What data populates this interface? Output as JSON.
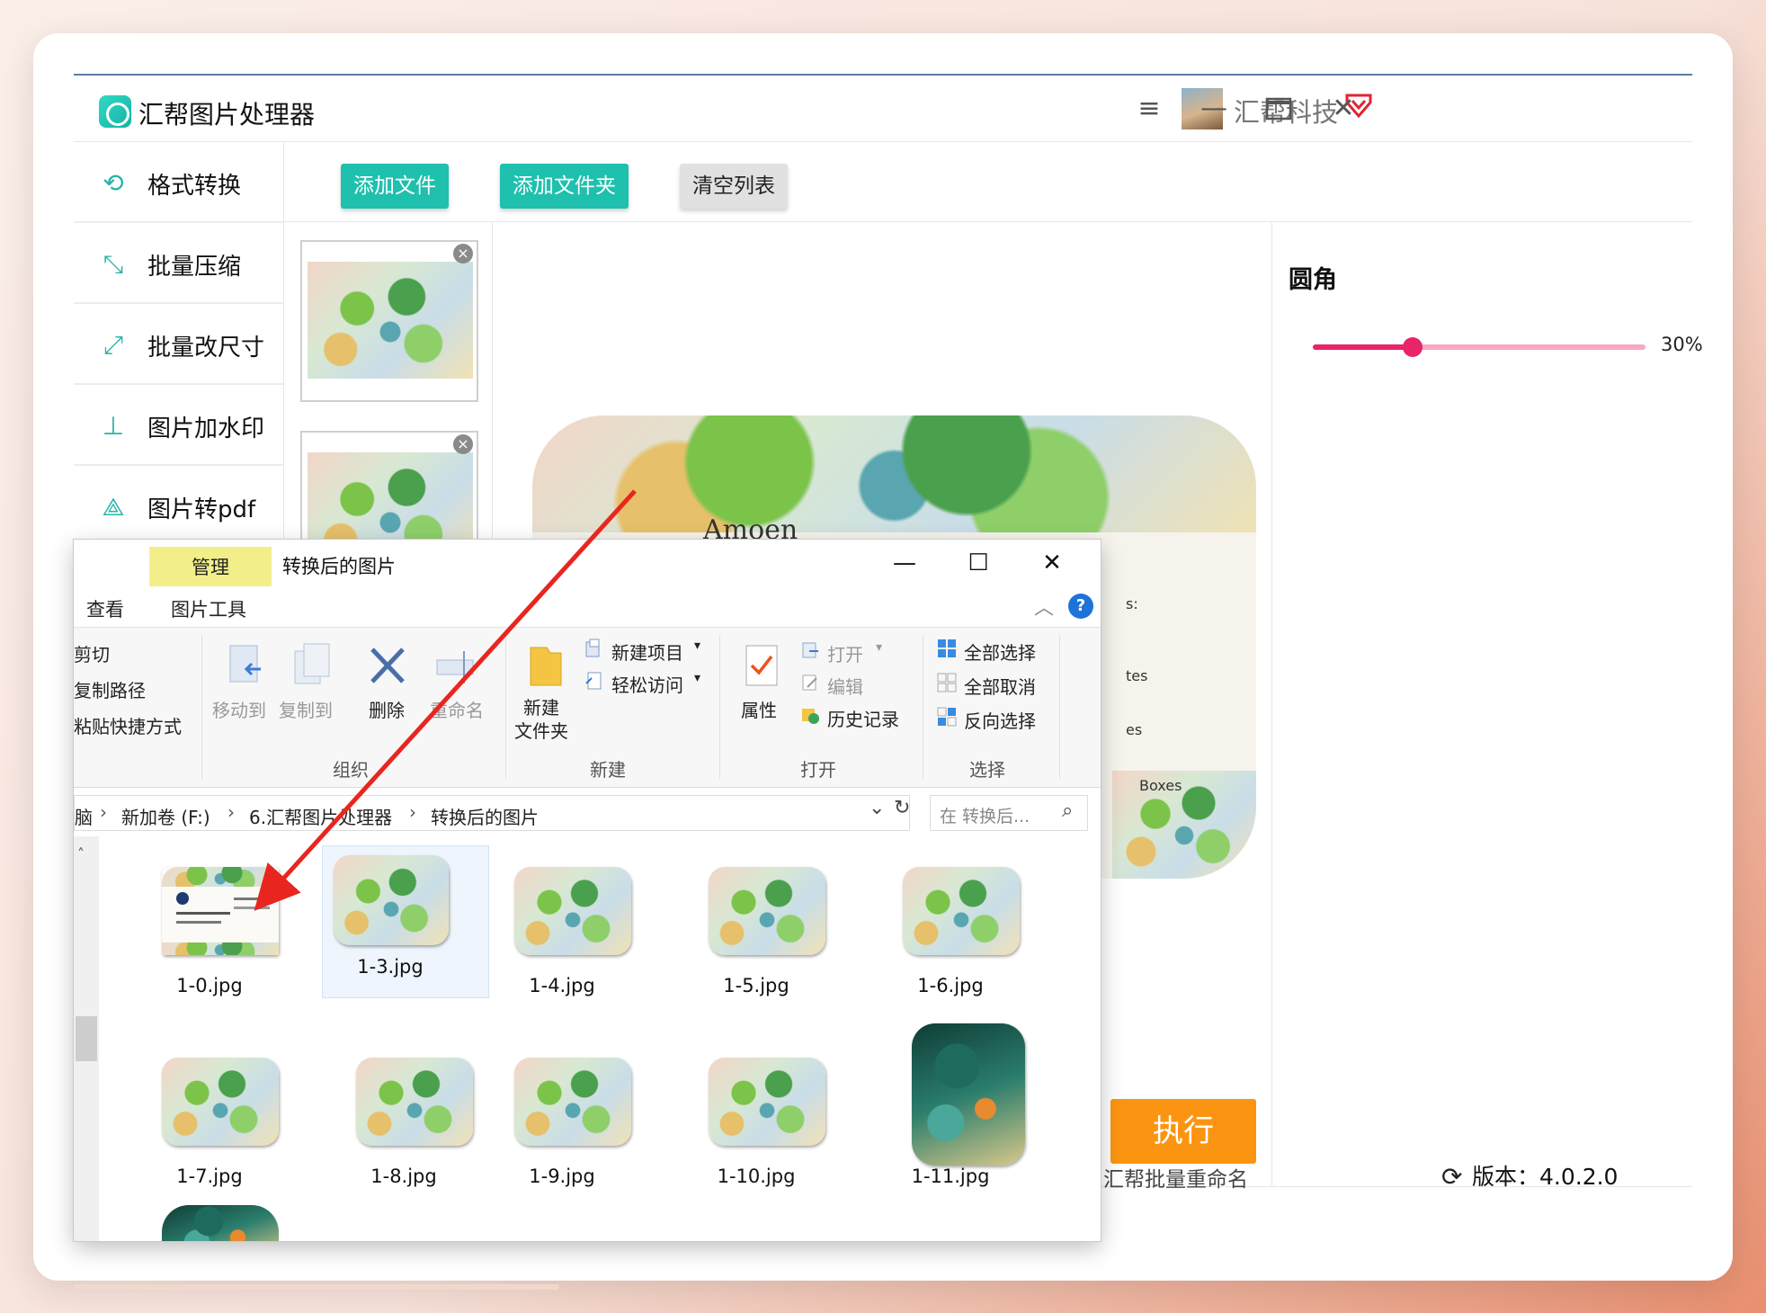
{
  "app": {
    "title": "汇帮图片处理器",
    "company": "汇帮科技",
    "window_controls": [
      "menu-icon",
      "minimize-icon",
      "maximize-icon",
      "close-icon"
    ]
  },
  "sidebar": {
    "items": [
      {
        "label": "格式转换",
        "icon": "format-convert-icon"
      },
      {
        "label": "批量压缩",
        "icon": "compress-icon"
      },
      {
        "label": "批量改尺寸",
        "icon": "resize-icon"
      },
      {
        "label": "图片加水印",
        "icon": "watermark-icon"
      },
      {
        "label": "图片转pdf",
        "icon": "pdf-icon"
      }
    ]
  },
  "toolbar": {
    "add_file": "添加文件",
    "add_folder": "添加文件夹",
    "clear_list": "清空列表"
  },
  "settings": {
    "title": "圆角",
    "slider_value_label": "30%",
    "slider_fraction": 0.3
  },
  "preview": {
    "texts": [
      "Amoen",
      "s:",
      "tes",
      "es",
      "Boxes"
    ]
  },
  "execute_label": "执行",
  "footer": {
    "link": "汇帮批量重命名",
    "version": "版本：4.0.2.0"
  },
  "explorer": {
    "manage_tab": "管理",
    "title": "转换后的图片",
    "tabs": [
      "查看",
      "图片工具"
    ],
    "ribbon": {
      "clipboard": [
        "剪切",
        "复制路径",
        "粘贴快捷方式"
      ],
      "move_to": "移动到",
      "copy_to": "复制到",
      "delete": "删除",
      "rename": "重命名",
      "organize": "组织",
      "new_folder": "新建\n文件夹",
      "new_item": "新建项目",
      "easy_access": "轻松访问",
      "new_group": "新建",
      "properties": "属性",
      "open": "打开",
      "edit": "编辑",
      "history": "历史记录",
      "open_group": "打开",
      "select_all": "全部选择",
      "select_none": "全部取消",
      "invert_select": "反向选择",
      "select_group": "选择"
    },
    "breadcrumb": [
      "脑",
      "新加卷 (F:)",
      "6.汇帮图片处理器",
      "转换后的图片"
    ],
    "search_placeholder": "在 转换后...",
    "files": [
      {
        "name": "1-0.jpg",
        "kind": "card"
      },
      {
        "name": "1-3.jpg",
        "kind": "leafy"
      },
      {
        "name": "1-4.jpg",
        "kind": "leafy"
      },
      {
        "name": "1-5.jpg",
        "kind": "leafy"
      },
      {
        "name": "1-6.jpg",
        "kind": "leafy"
      },
      {
        "name": "1-7.jpg",
        "kind": "leafy"
      },
      {
        "name": "1-8.jpg",
        "kind": "leafy"
      },
      {
        "name": "1-9.jpg",
        "kind": "leafy"
      },
      {
        "name": "1-10.jpg",
        "kind": "leafy"
      },
      {
        "name": "1-11.jpg",
        "kind": "teal"
      }
    ]
  },
  "colors": {
    "teal": "#1fc0ad",
    "accent_pink": "#e9246a",
    "execute_orange": "#fb9511",
    "arrow_red": "#e8261f"
  }
}
